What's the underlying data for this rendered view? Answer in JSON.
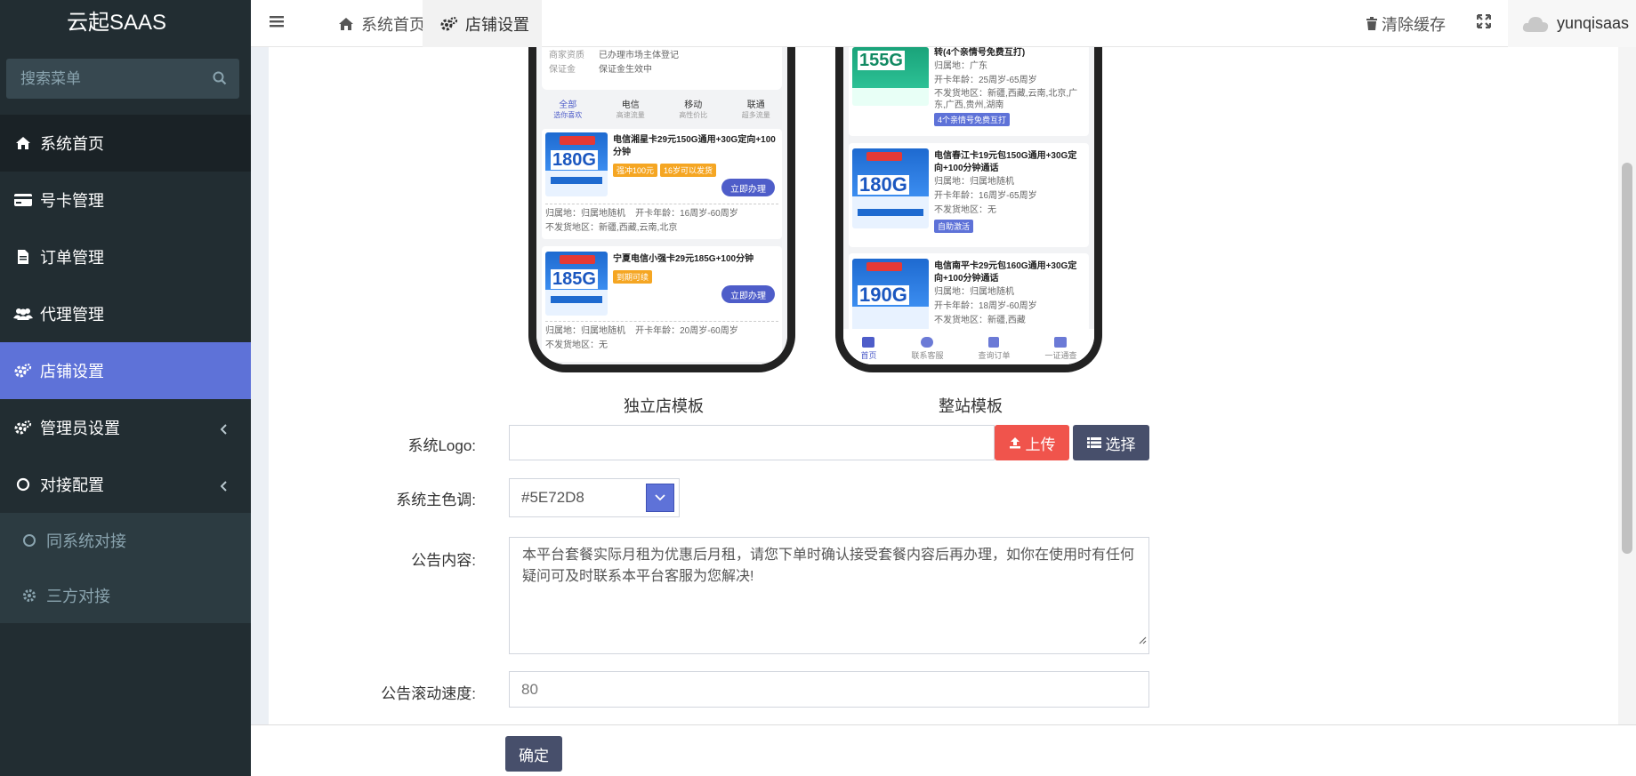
{
  "brand": {
    "title": "云起SAAS"
  },
  "search": {
    "placeholder": "搜索菜单"
  },
  "sidebar": {
    "items": [
      {
        "label": "系统首页",
        "icon": "home-icon"
      },
      {
        "label": "号卡管理",
        "icon": "credit-card-icon"
      },
      {
        "label": "订单管理",
        "icon": "file-icon"
      },
      {
        "label": "代理管理",
        "icon": "users-icon"
      },
      {
        "label": "店铺设置",
        "icon": "cogs-icon"
      },
      {
        "label": "管理员设置",
        "icon": "cogs-icon"
      },
      {
        "label": "对接配置",
        "icon": "circle-icon"
      }
    ],
    "subitems": [
      {
        "label": "同系统对接",
        "icon": "circle-icon"
      },
      {
        "label": "三方对接",
        "icon": "gear-icon"
      }
    ]
  },
  "topbar": {
    "tabs": [
      {
        "label": "系统首页",
        "icon": "home-icon"
      },
      {
        "label": "店铺设置",
        "icon": "cogs-icon"
      }
    ],
    "clear_cache": "清除缓存",
    "username": "yunqisaas"
  },
  "templates": {
    "standalone": "独立店模板",
    "fullsite": "整站模板"
  },
  "phone1": {
    "info": [
      {
        "k": "商家资质",
        "v": "已办理市场主体登记"
      },
      {
        "k": "保证金",
        "v": "保证金生效中"
      }
    ],
    "tabs": [
      {
        "label": "全部",
        "sub": "选你喜欢"
      },
      {
        "label": "电信",
        "sub": "高速流量"
      },
      {
        "label": "移动",
        "sub": "高性价比"
      },
      {
        "label": "联通",
        "sub": "超多流量"
      }
    ],
    "cards": [
      {
        "title": "电信湘星卡29元150G通用+30G定向+100分钟",
        "big": "180G",
        "chips": [
          "强冲100元",
          "16岁可以发货"
        ],
        "btn": "立即办理",
        "attr": "归属地：归属地随机    开卡年龄：16周岁-60周岁",
        "noship": "不发货地区：新疆,西藏,云南,北京"
      },
      {
        "title": "宁夏电信小强卡29元185G+100分钟",
        "big": "185G",
        "chips": [
          "到期可续"
        ],
        "btn": "立即办理",
        "attr": "归属地：归属地随机    开卡年龄：20周岁-60周岁",
        "noship": "不发货地区：无"
      }
    ]
  },
  "phone2": {
    "card0": {
      "big": "155G",
      "title": "转(4个亲情号免费互打)",
      "attr1": "归属地：广东",
      "attr2": "开卡年龄：25周岁-65周岁",
      "noship": "不发货地区：新疆,西藏,云南,北京,广东,广西,贵州,湖南",
      "chip": "4个亲情号免费互打"
    },
    "cards": [
      {
        "title": "电信春江卡19元包150G通用+30G定向+100分钟通话",
        "big": "180G",
        "attr1": "归属地：归属地随机",
        "attr2": "开卡年龄：16周岁-65周岁",
        "noship": "不发货地区：无",
        "chip": "自助激活"
      },
      {
        "title": "电信南平卡29元包160G通用+30G定向+100分钟通话",
        "big": "190G",
        "attr1": "归属地：归属地随机",
        "attr2": "开卡年龄：18周岁-60周岁",
        "noship": "不发货地区：新疆,西藏"
      }
    ],
    "nav": [
      "首页",
      "联系客服",
      "查询订单",
      "一证通查"
    ]
  },
  "form": {
    "logo_label": "系统Logo:",
    "logo_value": "",
    "upload": "上传",
    "select": "选择",
    "color_label": "系统主色调:",
    "color_value": "#5E72D8",
    "notice_label": "公告内容:",
    "notice_value": "本平台套餐实际月租为优惠后月租，请您下单时确认接受套餐内容后再办理，如你在使用时有任何疑问可及时联系本平台客服为您解决!",
    "speed_label": "公告滚动速度:",
    "speed_value": "80",
    "submit": "确定"
  },
  "colors": {
    "accent": "#5e72d8",
    "sidebar": "#222d32",
    "danger": "#f0544c",
    "dark_button": "#474f6b"
  }
}
